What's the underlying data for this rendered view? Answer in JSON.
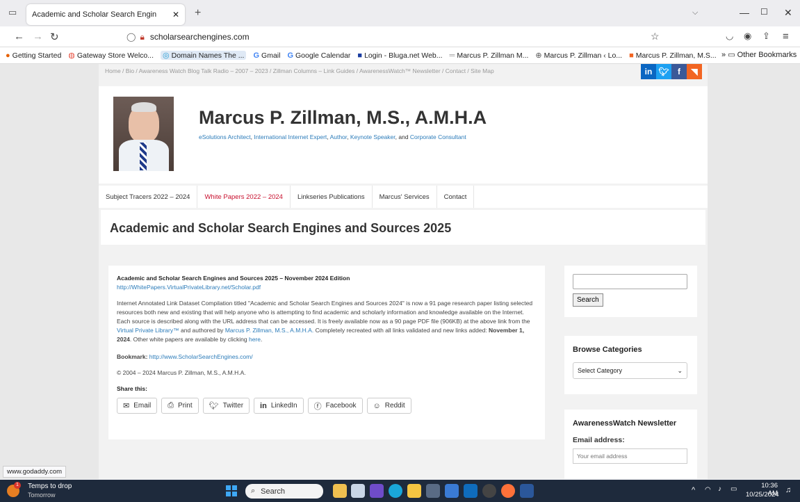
{
  "browser": {
    "tab_title": "Academic and Scholar Search Engin",
    "url": "scholarsearchengines.com",
    "status_url": "www.godaddy.com",
    "bookmarks": [
      "Getting Started",
      "Gateway Store Welco...",
      "Domain Names The ...",
      "Gmail",
      "Google Calendar",
      "Login - Bluga.net Web...",
      "Marcus P. Zillman M...",
      "Marcus P. Zillman ‹ Lo...",
      "Marcus P. Zillman, M.S..."
    ],
    "other_bookmarks": "Other Bookmarks"
  },
  "site": {
    "breadcrumb": "Home  /  Bio  /  Awareness Watch Blog Talk Radio – 2007 – 2023  /  Zillman Columns – Link Guides  /  AwarenessWatch™ Newsletter  /  Contact  /  Site Map",
    "title": "Marcus P. Zillman, M.S., A.M.H.A",
    "tagline_1": "eSolutions Architect",
    "tagline_2": "International Internet Expert",
    "tagline_3": "Author",
    "tagline_4": "Keynote Speaker",
    "tagline_and": "and",
    "tagline_5": "Corporate Consultant",
    "social": [
      "in",
      "t",
      "f",
      "rss"
    ],
    "menu": [
      "Subject Tracers 2022 – 2024",
      "White Papers 2022 – 2024",
      "Linkseries Publications",
      "Marcus' Services",
      "Contact"
    ]
  },
  "colors": {
    "accent": "#2b7bb9",
    "menu_active": "#c8102e",
    "linkedin": "#0a66c2",
    "twitter": "#1da1f2",
    "facebook": "#3b5998",
    "rss": "#f26522"
  },
  "main": {
    "page_title": "Academic and Scholar Search Engines and Sources 2025",
    "heading": "Academic and Scholar Search Engines and Sources 2025 – November 2024 Edition",
    "pdf_link": "http://WhitePapers.VirtualPrivateLibrary.net/Scholar.pdf",
    "para_1": "Internet Annotated Link Dataset Compilation titled \"Academic and Scholar Search Engines and Sources 2024\" is now a 91 page research paper listing selected resources both new and existing that will help anyone who is attempting to find academic and scholarly information and knowledge available on the Internet. Each source is described along with the URL address that can be accessed. It is freely available now as a 90 page PDF file (906KB) at the above link from the",
    "para_link_vpl": "Virtual Private Library™",
    "para_and_authored": "and authored by",
    "para_link_author": "Marcus P. Zillman, M.S., A.M.H.A.",
    "para_2": "Completely recreated with all links validated and new links added:",
    "para_date": "November 1, 2024",
    "para_3": ". Other white papers are available by clicking",
    "para_link_here": "here",
    "bookmark_label": "Bookmark:",
    "bookmark_url": "http://www.ScholarSearchEngines.com/",
    "copyright": "© 2004 –  2024 Marcus P. Zillman, M.S., A.M.H.A.",
    "share_label": "Share this:",
    "share": [
      "Email",
      "Print",
      "Twitter",
      "LinkedIn",
      "Facebook",
      "Reddit"
    ]
  },
  "sidebar": {
    "search_button": "Search",
    "browse_title": "Browse Categories",
    "select_value": "Select Category",
    "newsletter_title": "AwarenessWatch Newsletter",
    "email_label": "Email address:",
    "email_placeholder": "Your email address"
  },
  "taskbar": {
    "weather_title": "Temps to drop",
    "weather_sub": "Tomorrow",
    "badge": "1",
    "search": "Search",
    "time": "10:36 AM",
    "date": "10/25/2024"
  }
}
